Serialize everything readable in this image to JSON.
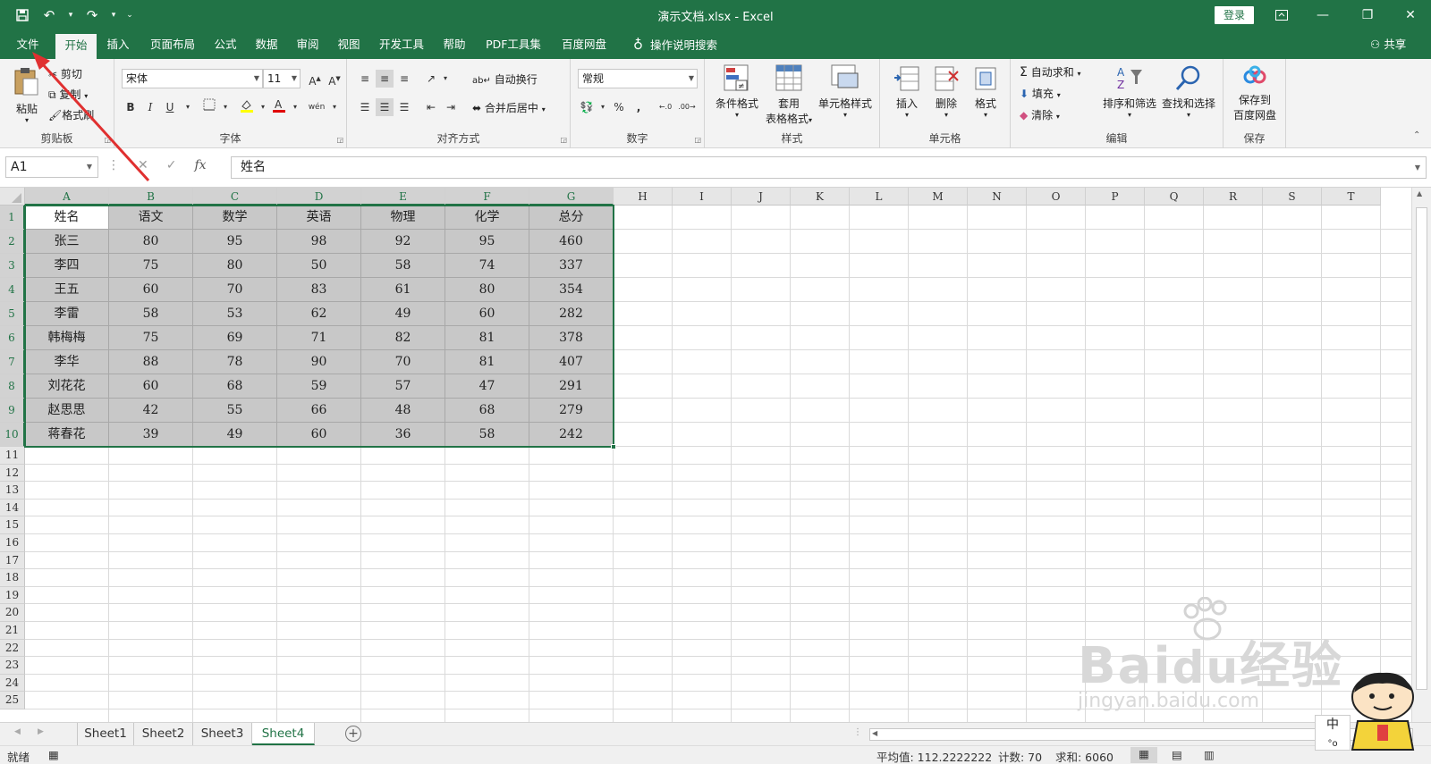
{
  "app": {
    "doc_title": "演示文档.xlsx - Excel",
    "login": "登录"
  },
  "qat": {
    "save_icon": "save-icon",
    "undo_icon": "undo-icon",
    "redo_icon": "redo-icon"
  },
  "tabs": [
    "文件",
    "开始",
    "插入",
    "页面布局",
    "公式",
    "数据",
    "审阅",
    "视图",
    "开发工具",
    "帮助",
    "PDF工具集",
    "百度网盘"
  ],
  "active_tab": "开始",
  "tell_me": "操作说明搜索",
  "share": "共享",
  "ribbon": {
    "clipboard": {
      "label": "剪贴板",
      "paste": "粘贴",
      "cut": "剪切",
      "copy": "复制",
      "format_painter": "格式刷"
    },
    "font": {
      "label": "字体",
      "name": "宋体",
      "size": "11",
      "bold": "B",
      "italic": "I",
      "underline": "U",
      "phonetic": "wén"
    },
    "alignment": {
      "label": "对齐方式",
      "wrap": "自动换行",
      "merge": "合并后居中"
    },
    "number": {
      "label": "数字",
      "format": "常规",
      "percent": "%",
      "comma": ","
    },
    "styles": {
      "label": "样式",
      "conditional": "条件格式",
      "table_format_1": "套用",
      "table_format_2": "表格格式",
      "cell_styles": "单元格样式"
    },
    "cells": {
      "label": "单元格",
      "insert": "插入",
      "delete": "删除",
      "format": "格式"
    },
    "editing": {
      "label": "编辑",
      "autosum": "自动求和",
      "fill": "填充",
      "clear": "清除",
      "sort_filter": "排序和筛选",
      "find_select": "查找和选择"
    },
    "save": {
      "label": "保存",
      "save_to_1": "保存到",
      "save_to_2": "百度网盘"
    }
  },
  "formula_bar": {
    "name_box": "A1",
    "fx": "fx",
    "content": "姓名"
  },
  "columns": [
    "A",
    "B",
    "C",
    "D",
    "E",
    "F",
    "G",
    "H",
    "I",
    "J",
    "K",
    "L",
    "M",
    "N",
    "O",
    "P",
    "Q",
    "R",
    "S",
    "T"
  ],
  "rows": [
    "1",
    "2",
    "3",
    "4",
    "5",
    "6",
    "7",
    "8",
    "9",
    "10",
    "11",
    "12",
    "13",
    "14",
    "15",
    "16",
    "17",
    "18",
    "19",
    "20",
    "21",
    "22",
    "23",
    "24",
    "25"
  ],
  "table": {
    "headers": [
      "姓名",
      "语文",
      "数学",
      "英语",
      "物理",
      "化学",
      "总分"
    ],
    "rows": [
      [
        "张三",
        "80",
        "95",
        "98",
        "92",
        "95",
        "460"
      ],
      [
        "李四",
        "75",
        "80",
        "50",
        "58",
        "74",
        "337"
      ],
      [
        "王五",
        "60",
        "70",
        "83",
        "61",
        "80",
        "354"
      ],
      [
        "李雷",
        "58",
        "53",
        "62",
        "49",
        "60",
        "282"
      ],
      [
        "韩梅梅",
        "75",
        "69",
        "71",
        "82",
        "81",
        "378"
      ],
      [
        "李华",
        "88",
        "78",
        "90",
        "70",
        "81",
        "407"
      ],
      [
        "刘花花",
        "60",
        "68",
        "59",
        "57",
        "47",
        "291"
      ],
      [
        "赵思思",
        "42",
        "55",
        "66",
        "48",
        "68",
        "279"
      ],
      [
        "蒋春花",
        "39",
        "49",
        "60",
        "36",
        "58",
        "242"
      ]
    ]
  },
  "sheets": [
    "Sheet1",
    "Sheet2",
    "Sheet3",
    "Sheet4"
  ],
  "active_sheet": "Sheet4",
  "status": {
    "ready": "就绪",
    "average": "平均值: 112.2222222",
    "count": "计数: 70",
    "sum": "求和: 6060"
  },
  "watermark": {
    "brand": "Bai",
    "brand_cn": "经验",
    "url": "jingyan.baidu.com"
  },
  "ime": {
    "mode": "中"
  },
  "colors": {
    "excel_green": "#217346",
    "selection_fill": "#c8c8c8",
    "arrow": "#e03030"
  }
}
